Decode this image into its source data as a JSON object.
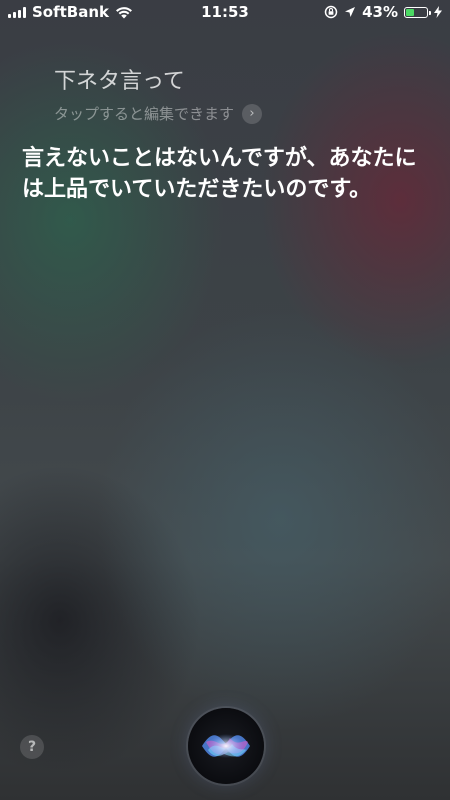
{
  "status_bar": {
    "carrier": "SoftBank",
    "time": "11:53",
    "battery_percent": "43%",
    "battery_level": 0.43,
    "icons": [
      "signal-icon",
      "wifi-icon",
      "rotation-lock-icon",
      "location-icon",
      "battery-icon",
      "charging-icon"
    ]
  },
  "siri": {
    "query": "下ネタ言って",
    "edit_hint": "タップすると編集できます",
    "response": "言えないことはないんですが、あなたには上品でいていただきたいのです。",
    "help_label": "?"
  },
  "colors": {
    "battery_green": "#4cd964",
    "text_primary": "#ffffff"
  }
}
